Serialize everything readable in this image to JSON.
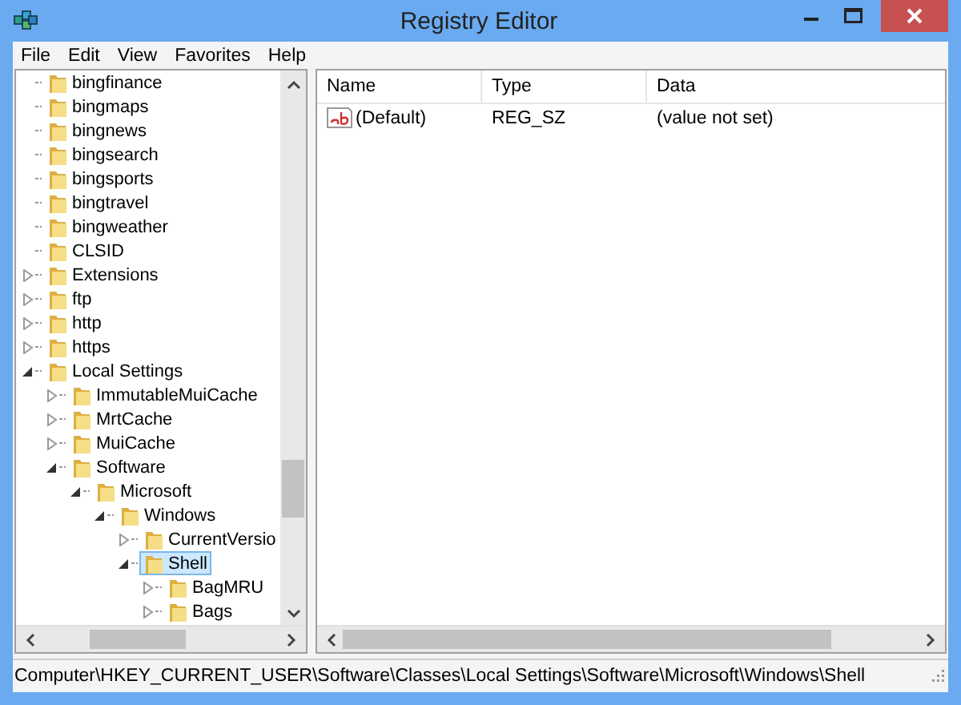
{
  "window": {
    "title": "Registry Editor"
  },
  "menu": [
    "File",
    "Edit",
    "View",
    "Favorites",
    "Help"
  ],
  "tree": [
    {
      "label": "bingfinance",
      "expandable": false,
      "selected": false
    },
    {
      "label": "bingmaps",
      "expandable": false,
      "selected": false
    },
    {
      "label": "bingnews",
      "expandable": false,
      "selected": false
    },
    {
      "label": "bingsearch",
      "expandable": false,
      "selected": false
    },
    {
      "label": "bingsports",
      "expandable": false,
      "selected": false
    },
    {
      "label": "bingtravel",
      "expandable": false,
      "selected": false
    },
    {
      "label": "bingweather",
      "expandable": false,
      "selected": false
    },
    {
      "label": "CLSID",
      "expandable": false,
      "selected": false
    },
    {
      "label": "Extensions",
      "expandable": true,
      "expanded": false,
      "selected": false
    },
    {
      "label": "ftp",
      "expandable": true,
      "expanded": false,
      "selected": false
    },
    {
      "label": "http",
      "expandable": true,
      "expanded": false,
      "selected": false
    },
    {
      "label": "https",
      "expandable": true,
      "expanded": false,
      "selected": false
    },
    {
      "label": "Local Settings",
      "expandable": true,
      "expanded": true,
      "selected": false,
      "children": [
        {
          "label": "ImmutableMuiCache",
          "expandable": true,
          "expanded": false,
          "selected": false
        },
        {
          "label": "MrtCache",
          "expandable": true,
          "expanded": false,
          "selected": false
        },
        {
          "label": "MuiCache",
          "expandable": true,
          "expanded": false,
          "selected": false
        },
        {
          "label": "Software",
          "expandable": true,
          "expanded": true,
          "selected": false,
          "children": [
            {
              "label": "Microsoft",
              "expandable": true,
              "expanded": true,
              "selected": false,
              "children": [
                {
                  "label": "Windows",
                  "expandable": true,
                  "expanded": true,
                  "selected": false,
                  "children": [
                    {
                      "label": "CurrentVersio",
                      "expandable": true,
                      "expanded": false,
                      "selected": false
                    },
                    {
                      "label": "Shell",
                      "expandable": true,
                      "expanded": true,
                      "selected": true,
                      "children": [
                        {
                          "label": "BagMRU",
                          "expandable": true,
                          "expanded": false,
                          "selected": false
                        },
                        {
                          "label": "Bags",
                          "expandable": true,
                          "expanded": false,
                          "selected": false
                        }
                      ]
                    }
                  ]
                }
              ]
            }
          ]
        }
      ]
    }
  ],
  "list": {
    "columns": [
      "Name",
      "Type",
      "Data"
    ],
    "rows": [
      {
        "name": "(Default)",
        "type": "REG_SZ",
        "data": "(value not set)"
      }
    ]
  },
  "status_bar": "Computer\\HKEY_CURRENT_USER\\Software\\Classes\\Local Settings\\Software\\Microsoft\\Windows\\Shell"
}
